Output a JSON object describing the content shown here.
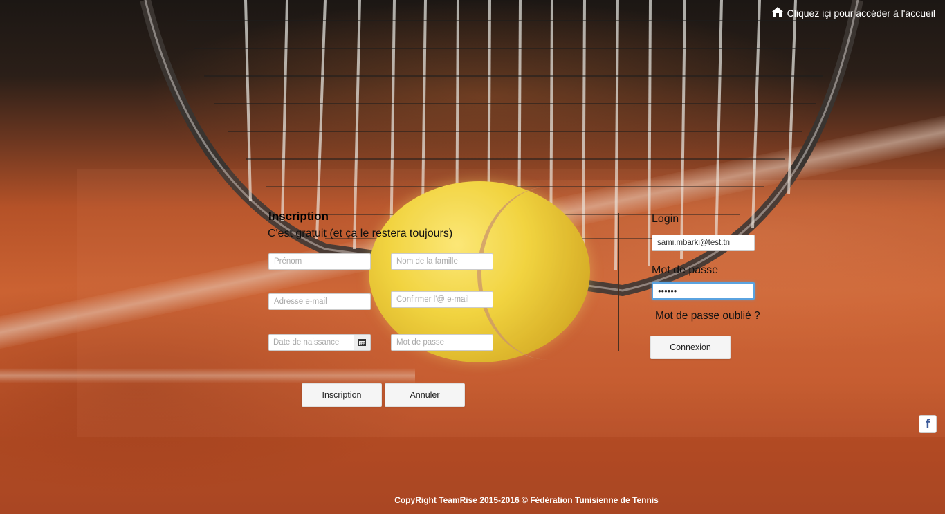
{
  "header": {
    "home_link": "Cliquez içi pour accéder à l'accueil",
    "home_icon": "home-icon"
  },
  "inscription": {
    "title": "Inscription",
    "subtitle": "C'est gratuit (et ça le restera toujours)",
    "fields": {
      "prenom": {
        "placeholder": "Prénom",
        "value": ""
      },
      "nom": {
        "placeholder": "Nom de la famille",
        "value": ""
      },
      "email": {
        "placeholder": "Adresse e-mail",
        "value": ""
      },
      "confirm_email": {
        "placeholder": "Confirmer l'@ e-mail",
        "value": ""
      },
      "birthdate": {
        "placeholder": "Date de naissance",
        "value": "",
        "icon": "calendar-icon"
      },
      "password": {
        "placeholder": "Mot de passe",
        "value": ""
      }
    },
    "submit_label": "Inscription",
    "cancel_label": "Annuler"
  },
  "login": {
    "login_label": "Login",
    "login_value": "sami.mbarki@test.tn",
    "password_label": "Mot de passe",
    "password_value": "••••••",
    "forgot_label": "Mot de passe oublié ?",
    "submit_label": "Connexion"
  },
  "social": {
    "facebook_icon": "facebook-icon",
    "facebook_glyph": "f"
  },
  "footer": {
    "copyright": "CopyRight TeamRise 2015-2016 © Fédération Tunisienne de Tennis"
  },
  "colors": {
    "clay": "#c55a2d",
    "ball": "#f3dc3c",
    "focus": "#5aa3e0",
    "facebook": "#3b5998"
  }
}
